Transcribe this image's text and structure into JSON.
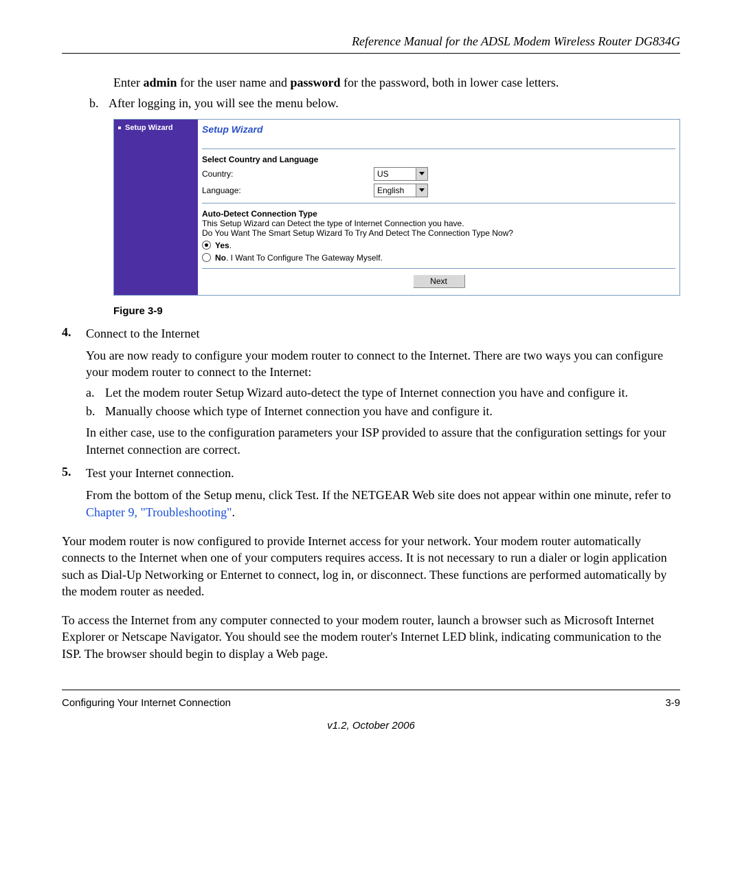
{
  "header": {
    "title": "Reference Manual for the ADSL Modem Wireless Router DG834G"
  },
  "intro": {
    "line1_pre": "Enter ",
    "line1_b1": "admin",
    "line1_mid1": " for the user name and ",
    "line1_b2": "password",
    "line1_post": " for the password, both in lower case letters.",
    "b_marker": "b.",
    "b_text": "After logging in, you will see the menu below."
  },
  "sidebar": {
    "item": "Setup Wizard"
  },
  "wizard": {
    "title": "Setup Wizard",
    "section1": "Select Country and Language",
    "country_label": "Country:",
    "country_value": "US",
    "language_label": "Language:",
    "language_value": "English",
    "section2": "Auto-Detect Connection Type",
    "desc1": "This Setup Wizard can Detect the type of Internet Connection you have.",
    "desc2": "Do You Want The Smart Setup Wizard To Try And Detect The Connection Type Now?",
    "opt_yes": "Yes",
    "opt_yes_suffix": ".",
    "opt_no_bold": "No",
    "opt_no_rest": ". I Want To Configure The Gateway Myself.",
    "next_label": "Next"
  },
  "figure_caption": "Figure 3-9",
  "steps": {
    "n4": "4.",
    "s4_title": "Connect to the Internet",
    "s4_p1": "You are now ready to configure your modem router to connect to the Internet. There are two ways you can configure your modem router to connect to the Internet:",
    "s4_a_marker": "a.",
    "s4_a": "Let the modem router Setup Wizard auto-detect the type of Internet connection you have and configure it.",
    "s4_b_marker": "b.",
    "s4_b": "Manually choose which type of Internet connection you have and configure it.",
    "s4_p2": "In either case, use to the configuration parameters your ISP provided to assure that the configuration settings for your Internet connection are correct.",
    "n5": "5.",
    "s5_title": "Test your Internet connection.",
    "s5_p1_pre": "From the bottom of the Setup menu, click Test. If the NETGEAR Web site does not appear within one minute, refer to ",
    "s5_link": "Chapter 9, \"Troubleshooting\"",
    "s5_p1_post": "."
  },
  "para1": "Your modem router is now configured to provide Internet access for your network. Your modem router automatically connects to the Internet when one of your computers requires access. It is not necessary to run a dialer or login application such as Dial-Up Networking or Enternet to connect, log in, or disconnect. These functions are performed automatically by the modem router as needed.",
  "para2": "To access the Internet from any computer connected to your modem router, launch a browser such as Microsoft Internet Explorer or Netscape Navigator. You should see the modem router's Internet LED blink, indicating communication to the ISP. The browser should begin to display a Web page.",
  "footer": {
    "left": "Configuring Your Internet Connection",
    "right": "3-9",
    "version": "v1.2, October 2006"
  }
}
